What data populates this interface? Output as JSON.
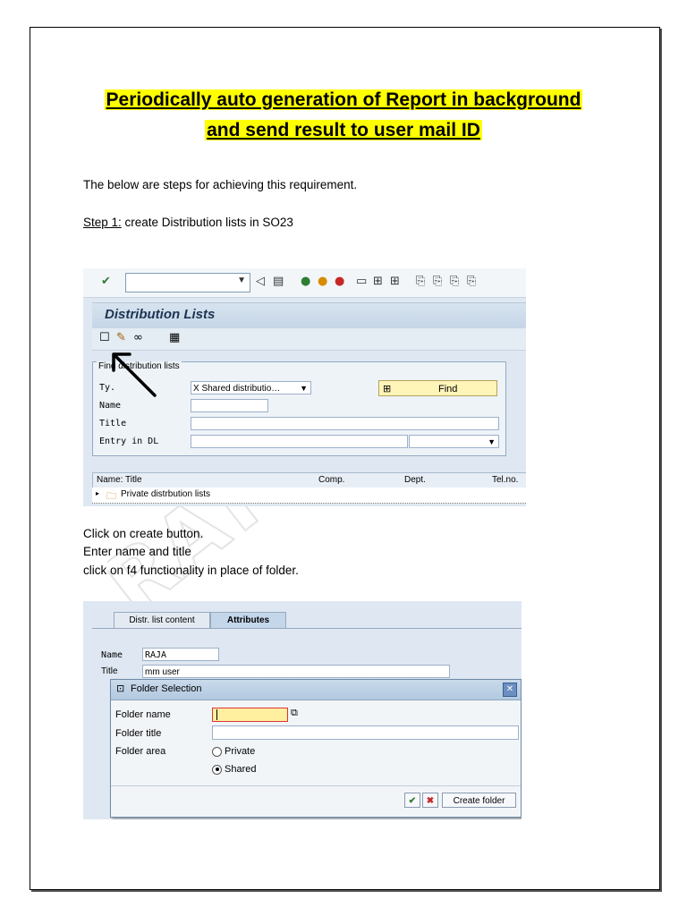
{
  "document": {
    "title_line1": "Periodically auto generation of Report in background",
    "title_line2": "and send result to user mail ID",
    "intro": "The below are steps for achieving this requirement.",
    "step1_label": "Step 1:",
    "step1_text": " create Distribution lists in SO23",
    "instructions": [
      "Click on create button.",
      "Enter name and title",
      "click on f4 functionality in place of folder."
    ],
    "watermark": "RATIN PRI"
  },
  "screen1": {
    "title": "Distribution Lists",
    "find_box": {
      "title": "Find distribution lists",
      "ty_label": "Ty.",
      "ty_value": "X Shared distributio…",
      "name_label": "Name",
      "title_label": "Title",
      "entry_label": "Entry in DL",
      "find_button": "Find"
    },
    "grid": {
      "columns": [
        "Name: Title",
        "Comp.",
        "Dept.",
        "Tel.no."
      ],
      "row1": "Private distrbution lists"
    }
  },
  "screen2": {
    "tabs": [
      "Distr. list content",
      "Attributes"
    ],
    "name_label": "Name",
    "name_value": "RAJA",
    "title_label": "Title",
    "title_value": "mm user",
    "dialog": {
      "title": "Folder Selection",
      "folder_name_label": "Folder name",
      "folder_title_label": "Folder title",
      "folder_area_label": "Folder area",
      "private_label": "Private",
      "shared_label": "Shared",
      "create_button": "Create folder"
    }
  },
  "colors": {
    "highlight": "#ffff00",
    "sap_bg": "#dfe8f2",
    "find_button": "#fff5b8"
  }
}
